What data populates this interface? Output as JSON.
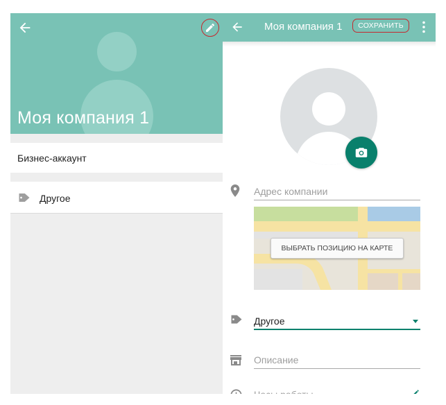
{
  "left": {
    "title": "Моя компания 1",
    "business_label": "Бизнес-аккаунт",
    "category_label": "Другое"
  },
  "right": {
    "title": "Моя компания 1",
    "save_label": "СОХРАНИТЬ",
    "address_placeholder": "Адрес компании",
    "map_button_label": "ВЫБРАТЬ ПОЗИЦИЮ НА КАРТЕ",
    "category_value": "Другое",
    "description_placeholder": "Описание",
    "hours_placeholder": "Часы работы"
  },
  "colors": {
    "header": "#79c2b5",
    "accent": "#09806c",
    "highlight_ring": "#c6282e"
  },
  "icons": {
    "back": "arrow-left-icon",
    "edit": "pencil-icon",
    "more": "more-vert-icon",
    "camera": "camera-icon",
    "location": "location-pin-icon",
    "category": "tag-icon",
    "description": "storefront-icon",
    "hours": "clock-icon"
  }
}
